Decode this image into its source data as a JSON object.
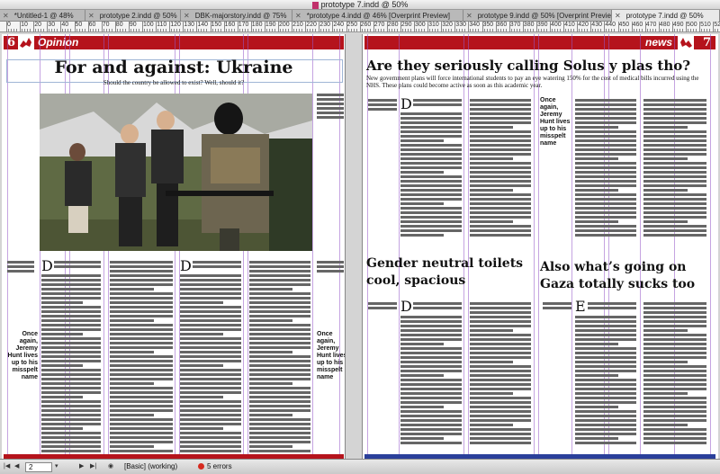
{
  "window": {
    "title": "prototype 7.indd @ 50%"
  },
  "tabs": [
    {
      "label": "*Untitled-1 @ 48%"
    },
    {
      "label": "prototype 2.indd @ 50%"
    },
    {
      "label": "DBK-majorstory.indd @ 75%"
    },
    {
      "label": "*prototype 4.indd @ 46% [Overprint Preview]"
    },
    {
      "label": "prototype 9.indd @ 50% [Overprint Preview]"
    },
    {
      "label": "prototype 7.indd @ 50%"
    }
  ],
  "ruler": {
    "labels": [
      "0",
      "10",
      "20",
      "30",
      "40",
      "50",
      "60",
      "70",
      "80",
      "90",
      "100",
      "110",
      "120",
      "130",
      "140",
      "150",
      "160",
      "170",
      "180",
      "190",
      "200",
      "210",
      "220",
      "230",
      "240",
      "250",
      "260",
      "270",
      "280",
      "290",
      "300",
      "310",
      "320",
      "330",
      "340",
      "350",
      "360",
      "370",
      "380",
      "390",
      "400",
      "410",
      "420",
      "430",
      "440",
      "450",
      "460",
      "470",
      "480",
      "490",
      "500",
      "510",
      "520"
    ]
  },
  "left_page": {
    "page_number": "6",
    "section": "Opinion",
    "headline": "For and against: Ukraine",
    "standfirst": "Should the country be allowed to exist? Well, should it?",
    "dropcap_1": "D",
    "dropcap_2": "D",
    "sidenote_left": "Once again, Jeremy Hunt lives up to his misspelt name",
    "sidenote_right": "Once again, Jeremy Hunt lives up to his misspelt name"
  },
  "right_page": {
    "page_number": "7",
    "section": "news",
    "headline_main": "Are they seriously calling Solus y plas tho?",
    "standfirst_main": "New government plans will force international students to pay an eye watering 150% for the cost of medical bills incurred using the NHS. These plans could become active as soon as this academic year.",
    "dropcap_main": "D",
    "sidenote": "Once again, Jeremy Hunt lives up to his misspelt name",
    "headline_2": "Gender neutral toilets cool, spacious",
    "dropcap_2": "D",
    "headline_3": "Also what’s going on Gaza totally sucks too",
    "dropcap_3": "E"
  },
  "status": {
    "page": "2",
    "style": "[Basic] (working)",
    "errors": "5 errors"
  },
  "colors": {
    "brand_red": "#b5131c",
    "footer_blue": "#2a3f9a",
    "guide_purple": "#9a5ac8"
  }
}
